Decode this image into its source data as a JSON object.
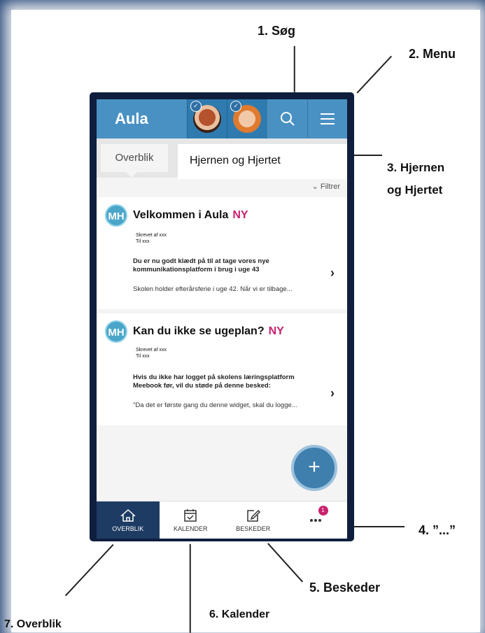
{
  "annotations": {
    "search": "1.  Søg",
    "menu": "2. Menu",
    "hjernen_line1": "3. Hjernen",
    "hjernen_line2": "og Hjertet",
    "more": "4. ”...”",
    "messages": "5. Beskeder",
    "calendar": "6. Kalender",
    "overview": "7. Overblik"
  },
  "app": {
    "logo": "Aula",
    "tab_overview": "Overblik",
    "dropdown_label": "Hjernen og Hjertet",
    "filter": "⌄ Filtrer",
    "fab": "+"
  },
  "posts": [
    {
      "avatar": "MH",
      "title": "Velkommen i Aula",
      "badge": "NY",
      "written_by": "Skrevet af xxx",
      "to": "Til xxx",
      "body": "Du er nu godt klædt på til at tage vores nye kommunikationsplatform i brug i uge 43",
      "preview": "Skolen holder efterårsferie i uge 42. Når vi er tilbage..."
    },
    {
      "avatar": "MH",
      "title": "Kan du ikke se ugeplan?",
      "badge": "NY",
      "written_by": "Skrevet af xxx",
      "to": "Til xxx",
      "body": "Hvis du ikke har logget på skolens læringsplatform Meebook før, vil du støde på denne besked:",
      "preview": "\"Da det er første gang du denne widget, skal du logge..."
    }
  ],
  "bottom_nav": {
    "overview": "OVERBLIK",
    "calendar": "KALENDER",
    "messages": "BESKEDER",
    "more_badge": "1"
  },
  "colors": {
    "topbar": "#4a91c3",
    "accent_ny": "#c8216e",
    "nav_active": "#1d3b63"
  }
}
